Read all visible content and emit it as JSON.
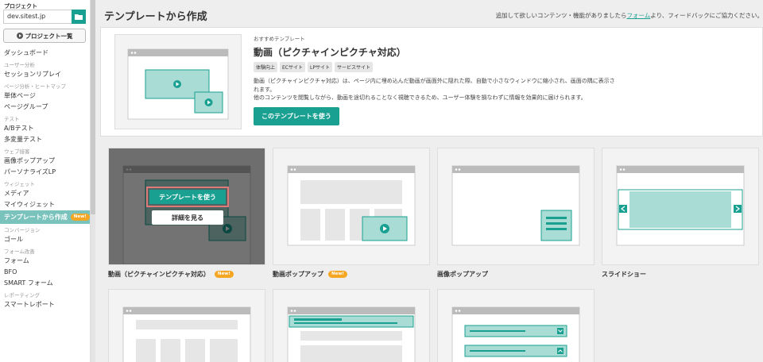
{
  "sidebar": {
    "project_label": "プロジェクト",
    "project_value": "dev.sitest.jp",
    "project_list_button": "プロジェクト一覧",
    "nav": [
      {
        "type": "item",
        "label": "ダッシュボード"
      },
      {
        "type": "section",
        "label": "ユーザー分析"
      },
      {
        "type": "item",
        "label": "セッションリプレイ"
      },
      {
        "type": "section",
        "label": "ページ分析・ヒートマップ"
      },
      {
        "type": "item",
        "label": "単体ページ"
      },
      {
        "type": "item",
        "label": "ページグループ"
      },
      {
        "type": "section",
        "label": "テスト"
      },
      {
        "type": "item",
        "label": "A/Bテスト"
      },
      {
        "type": "item",
        "label": "多変量テスト"
      },
      {
        "type": "section",
        "label": "ウェブ接客"
      },
      {
        "type": "item",
        "label": "画像ポップアップ"
      },
      {
        "type": "item",
        "label": "パーソナライズLP"
      },
      {
        "type": "section",
        "label": "ウィジェット"
      },
      {
        "type": "item",
        "label": "メディア"
      },
      {
        "type": "item",
        "label": "マイウィジェット"
      },
      {
        "type": "active",
        "label": "テンプレートから作成",
        "badge": "New!"
      },
      {
        "type": "section",
        "label": "コンバージョン"
      },
      {
        "type": "item",
        "label": "ゴール"
      },
      {
        "type": "section",
        "label": "フォーム改善"
      },
      {
        "type": "item",
        "label": "フォーム"
      },
      {
        "type": "item",
        "label": "BFO"
      },
      {
        "type": "item",
        "label": "SMART フォーム"
      },
      {
        "type": "section",
        "label": "レポーティング"
      },
      {
        "type": "item",
        "label": "スマートレポート"
      }
    ]
  },
  "header": {
    "title": "テンプレートから作成",
    "feedback_before": "追加して欲しいコンテンツ・機能がありましたら",
    "feedback_link": "フォーム",
    "feedback_after": "より、フィードバックにご協力ください。"
  },
  "featured": {
    "recommended_label": "おすすめテンプレート",
    "title": "動画（ピクチャインピクチャ対応）",
    "tags": [
      "体験向上",
      "ECサイト",
      "LPサイト",
      "サービスサイト"
    ],
    "desc_line1": "動画（ピクチャインピクチャ対応）は、ページ内に埋め込んだ動画が画面外に隠れた際、自動で小さなウィンドウに縮小され、画面の隅に表示されます。",
    "desc_line2": "他のコンテンツを閲覧しながら、動画を途切れることなく視聴できるため、ユーザー体験を損なわずに情報を効果的に届けられます。",
    "use_button": "このテンプレートを使う"
  },
  "cards": [
    {
      "label": "動画（ピクチャインピクチャ対応）",
      "badge": "New!"
    },
    {
      "label": "動画ポップアップ",
      "badge": "New!"
    },
    {
      "label": "画像ポップアップ",
      "badge": ""
    },
    {
      "label": "スライドショー",
      "badge": ""
    }
  ],
  "hover_overlay": {
    "use_button": "テンプレートを使う",
    "detail_button": "詳細を見る"
  },
  "colors": {
    "accent": "#1aa091",
    "accent_light": "#a8dcd5",
    "badge": "#f5a623"
  }
}
